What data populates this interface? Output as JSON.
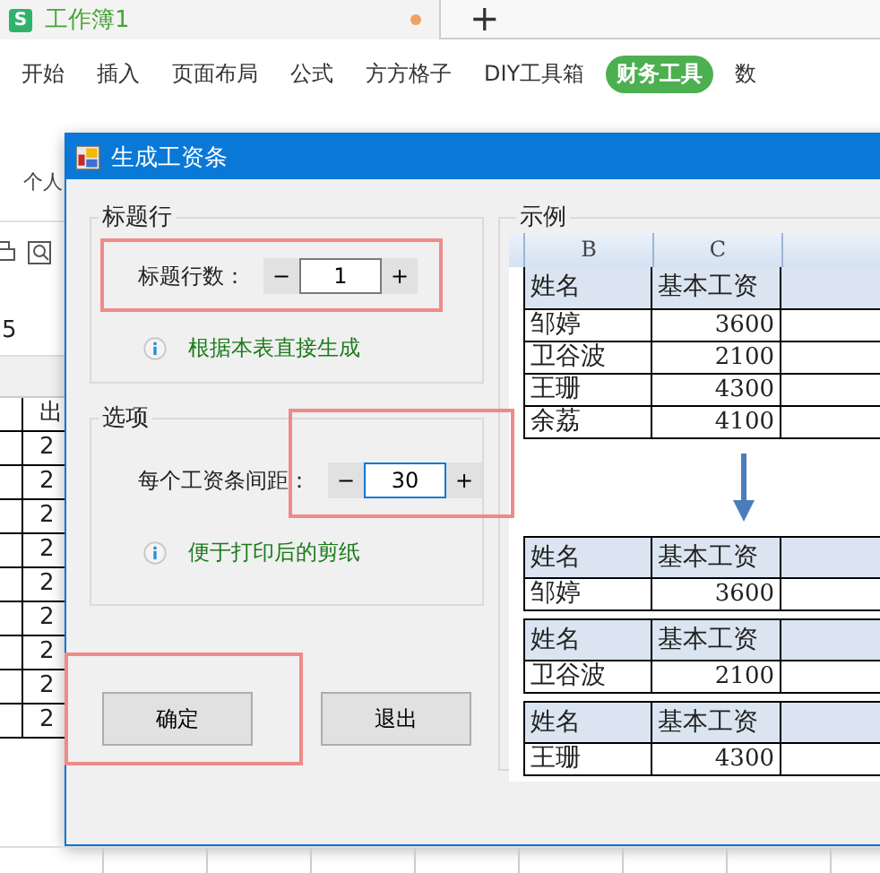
{
  "app_tab": {
    "logo": "S",
    "title": "工作簿1",
    "unsaved": true,
    "new_tab": "+"
  },
  "ribbon_tabs": [
    {
      "label": "开始",
      "selected": false
    },
    {
      "label": "插入",
      "selected": false
    },
    {
      "label": "页面布局",
      "selected": false
    },
    {
      "label": "公式",
      "selected": false
    },
    {
      "label": "方方格子",
      "selected": false
    },
    {
      "label": "DIY工具箱",
      "selected": false
    },
    {
      "label": "财务工具",
      "selected": true
    },
    {
      "label": "数",
      "selected": false
    }
  ],
  "toolbar": {
    "label": "个人"
  },
  "name_box": "5",
  "sheet": {
    "header": "出",
    "cells": [
      "2",
      "2",
      "2",
      "2",
      "2",
      "2",
      "2",
      "2",
      "2"
    ]
  },
  "dialog": {
    "title": "生成工资条",
    "groups": [
      {
        "title": "标题行",
        "label": "标题行数：",
        "minus": "−",
        "value": "1",
        "plus": "+",
        "focused": false,
        "highlighted": true,
        "hint": "根据本表直接生成"
      },
      {
        "title": "选项",
        "label": "每个工资条间距：",
        "minus": "−",
        "value": "30",
        "plus": "+",
        "focused": true,
        "highlighted": true,
        "hint": "便于打印后的剪纸"
      }
    ],
    "buttons": [
      {
        "label": "确定",
        "highlighted": true
      },
      {
        "label": "退出",
        "highlighted": false
      }
    ],
    "example": {
      "title": "示例",
      "columns": [
        "B",
        "C"
      ],
      "header": [
        "姓名",
        "基本工资"
      ],
      "rows": [
        [
          "邹婷",
          "3600"
        ],
        [
          "卫谷波",
          "2100"
        ],
        [
          "王珊",
          "4300"
        ],
        [
          "余荔",
          "4100"
        ]
      ],
      "slips": [
        {
          "header": [
            "姓名",
            "基本工资"
          ],
          "row": [
            "邹婷",
            "3600"
          ]
        },
        {
          "header": [
            "姓名",
            "基本工资"
          ],
          "row": [
            "卫谷波",
            "2100"
          ]
        },
        {
          "header": [
            "姓名",
            "基本工资"
          ],
          "row": [
            "王珊",
            "4300"
          ]
        }
      ]
    }
  }
}
